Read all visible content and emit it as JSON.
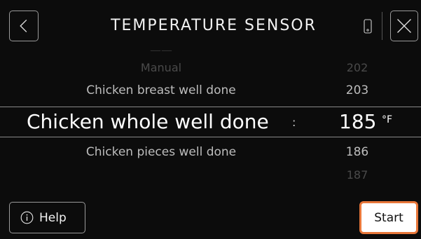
{
  "header": {
    "title": "TEMPERATURE SENSOR",
    "back_icon": "chevron-left-icon",
    "device_icon": "phone-icon",
    "close_icon": "close-icon"
  },
  "picker": {
    "items": [
      {
        "name": "Manual",
        "value": "202"
      },
      {
        "name": "Chicken breast well done",
        "value": "203"
      },
      {
        "name": "Chicken whole well done",
        "value": "185"
      },
      {
        "name": "Chicken pieces well done",
        "value": "186"
      },
      {
        "name": "",
        "value": "187"
      }
    ],
    "selected_index": 2,
    "separator": ":",
    "unit": "°F"
  },
  "footer": {
    "help_label": "Help",
    "help_icon": "info-circle-icon",
    "start_label": "Start"
  },
  "colors": {
    "accent": "#e8773a",
    "background": "#0c0c0c"
  }
}
